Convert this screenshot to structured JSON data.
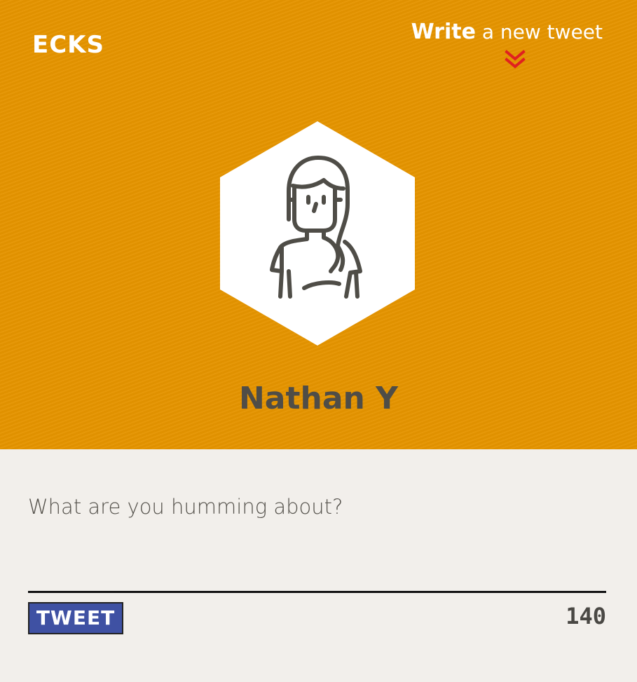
{
  "brand": {
    "logo_text": "ECKS"
  },
  "header": {
    "write_strong": "Write",
    "write_rest": " a new tweet",
    "chevron_color": "#e02020",
    "background_color": "#e59400"
  },
  "profile": {
    "name": "Nathan Y",
    "avatar_icon": "person-avatar-icon"
  },
  "composer": {
    "placeholder": "What are you humming about?",
    "value": ""
  },
  "actions": {
    "tweet_label": "TWEET",
    "tweet_color": "#3f51a3",
    "char_counter": "140"
  }
}
